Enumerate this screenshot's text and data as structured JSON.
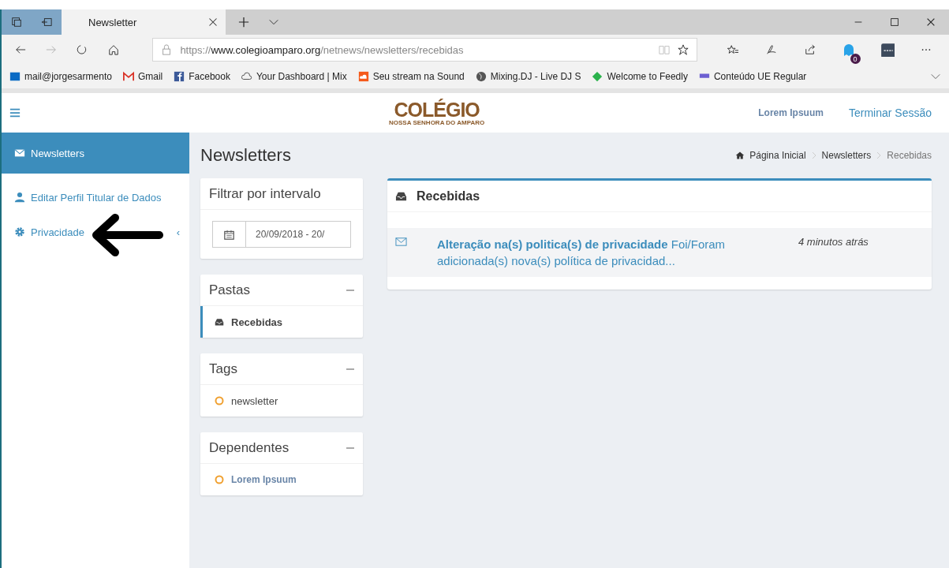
{
  "browser": {
    "tab": {
      "title": "Newsletter"
    },
    "url": {
      "scheme": "https://",
      "domain": "www.colegioamparo.org",
      "path": "/netnews/newsletters/recebidas"
    },
    "extension_badge": "0",
    "bookmarks": [
      {
        "label": "mail@jorgesarmento",
        "kind": "mail"
      },
      {
        "label": "Gmail",
        "kind": "gmail"
      },
      {
        "label": "Facebook",
        "kind": "facebook"
      },
      {
        "label": "Your Dashboard | Mix",
        "kind": "cloud"
      },
      {
        "label": "Seu stream na Sound",
        "kind": "soundcloud"
      },
      {
        "label": "Mixing.DJ - Live DJ S",
        "kind": "globe"
      },
      {
        "label": "Welcome to Feedly",
        "kind": "feedly"
      },
      {
        "label": "Conteúdo UE Regular",
        "kind": "bars"
      }
    ]
  },
  "header": {
    "logo": {
      "title": "COLÉGIO",
      "subtitle": "NOSSA SENHORA DO AMPARO"
    },
    "user": "Lorem Ipsuum",
    "logout": "Terminar Sessão"
  },
  "sidebar": {
    "items": [
      {
        "label": "Newsletters",
        "kind": "envelope",
        "selected": true
      },
      {
        "label": "Editar Perfil Titular de Dados",
        "kind": "user",
        "selected": false
      },
      {
        "label": "Privacidade",
        "kind": "gear",
        "selected": false,
        "caret": "‹"
      }
    ]
  },
  "page_title": "Newsletters",
  "breadcrumb": [
    {
      "label": "Página Inicial",
      "current": false
    },
    {
      "label": "Newsletters",
      "current": false
    },
    {
      "label": "Recebidas",
      "current": true
    }
  ],
  "filter": {
    "title": "Filtrar por intervalo",
    "value": "20/09/2018 - 20/"
  },
  "panels": [
    {
      "title": "Pastas",
      "items": [
        {
          "kind": "folder",
          "label": "Recebidas",
          "selected": true
        }
      ]
    },
    {
      "title": "Tags",
      "items": [
        {
          "kind": "tag",
          "label": "newsletter",
          "color": "#f0a030"
        }
      ]
    },
    {
      "title": "Dependentes",
      "items": [
        {
          "kind": "person",
          "label": "Lorem Ipsuum",
          "color": "#f0a030"
        }
      ]
    }
  ],
  "inbox": {
    "title": "Recebidas",
    "messages": [
      {
        "subject": "Alteração na(s) politica(s) de privacidade",
        "excerpt": "Foi/Foram adicionada(s) nova(s) política de privacidad...",
        "time": "4 minutos atrás",
        "unread": true
      }
    ]
  }
}
